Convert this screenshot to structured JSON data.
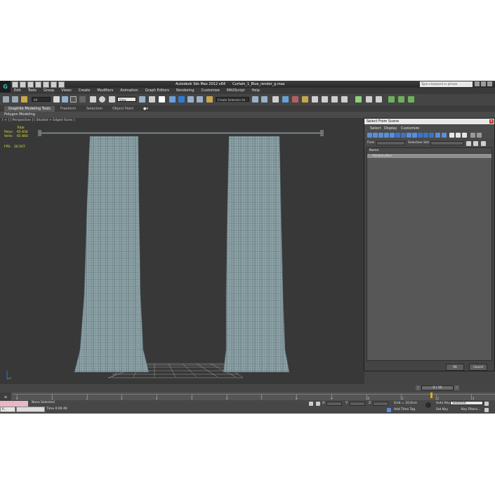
{
  "window": {
    "title": "Autodesk 3ds Max 2012 x64",
    "file": "Curtain_1_Blue_render_g.max",
    "search_placeholder": "Type a keyword or phrase"
  },
  "menu": [
    "Edit",
    "Tools",
    "Group",
    "Views",
    "Create",
    "Modifiers",
    "Animation",
    "Graph Editors",
    "Rendering",
    "Customize",
    "MAXScript",
    "Help"
  ],
  "toolbar": {
    "filter_value": "All",
    "coord_value": "View",
    "named_set_placeholder": "Create Selection Se"
  },
  "ribbon": {
    "tabs": [
      "Graphite Modeling Tools",
      "Freeform",
      "Selection",
      "Object Paint"
    ],
    "panel_label": "Polygon Modeling"
  },
  "viewport": {
    "label": "[ + ] [ Perspective ] [ Shaded + Edged Faces ]",
    "stats_header": "Total",
    "polys_label": "Polys:",
    "polys_value": "65 834",
    "verts_label": "Verts:",
    "verts_value": "65 860",
    "fps_label": "FPS:",
    "fps_value": "26.507"
  },
  "dialog": {
    "title": "Select From Scene",
    "menu": [
      "Select",
      "Display",
      "Customize"
    ],
    "find_label": "Find:",
    "selection_set_label": "Selection Set:",
    "column_name": "Name",
    "rows": [
      "Rendern-Blue"
    ],
    "ok_label": "OK",
    "cancel_label": "Cancel"
  },
  "timeline": {
    "frame_indicator": "0 / 10",
    "ticks": [
      "0",
      "1",
      "2",
      "3",
      "4",
      "5",
      "6",
      "7",
      "8",
      "9",
      "10",
      "11",
      "12",
      "13"
    ]
  },
  "status": {
    "script_label": "R..",
    "selection_status": "None Selected",
    "time_label": "Time  0:00:40",
    "x_label": "X:",
    "y_label": "Y:",
    "z_label": "Z:",
    "grid_label": "Grid = 10,0cm",
    "add_time_tag": "Add Time Tag",
    "auto_key": "Auto Key",
    "selected_value": "Selected",
    "set_key": "Set Key",
    "key_filters": "Key Filters..."
  },
  "colors": {
    "background": "#444444",
    "viewport": "#383838",
    "curtain": "#8fa4a8",
    "stats_text": "#e4e434"
  }
}
